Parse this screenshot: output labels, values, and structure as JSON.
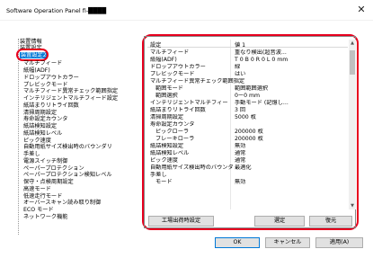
{
  "window": {
    "title": "Software Operation Panel fi-████",
    "close_glyph": "✕"
  },
  "tree": {
    "root_items": [
      "装置情報",
      "装置設定",
      "装置設定2"
    ],
    "selected": "装置設定2",
    "children": [
      "マルチフィード",
      "紙幅(ADF)",
      "ドロップアウトカラー",
      "プレビックモード",
      "マルチフィード異常チェック範囲指定",
      "インテリジェントマルチフィード設定",
      "紙詰まりリトライ回数",
      "清掃周期設定",
      "寿命設定カウンタ",
      "紙詰検知設定",
      "紙詰検知レベル",
      "ピック速度",
      "自動用紙サイズ検出時のバウンダリ",
      "手差し",
      "電源スイッチ制御",
      "ペーパープロテクション",
      "ペーパープロテクション検知レベル",
      "保守・点検周期設定",
      "高速モード",
      "低速走行モード",
      "オーバースキャン読み取り制御",
      "ECO モード",
      "ネットワーク機能"
    ]
  },
  "grid": {
    "col_setting": "設定",
    "col_value": "値 1",
    "rows": [
      [
        "マルチフィード",
        "重なり検出(超音波..."
      ],
      [
        "紙幅(ADF)",
        "T 0  B 0  R 0  L 0 mm"
      ],
      [
        "ドロップアウトカラー",
        "緑"
      ],
      [
        "プレビックモード",
        "はい"
      ],
      [
        "マルチフィード異常チェック範囲指定",
        ""
      ],
      [
        "範囲モード",
        "範囲範囲選択"
      ],
      [
        "範囲選択",
        "0ー0 mm"
      ],
      [
        "インテリジェントマルチフィード設定",
        "手動モード (記憶し..."
      ],
      [
        "紙詰まりリトライ回数",
        "3 回"
      ],
      [
        "清掃周期設定",
        "5000 枚"
      ],
      [
        "寿命設定カウンタ",
        ""
      ],
      [
        "ピックローラ",
        "200000 枚"
      ],
      [
        "ブレーキローラ",
        "200000 枚"
      ],
      [
        "紙詰検知設定",
        "無効"
      ],
      [
        "紙詰検知レベル",
        "通常"
      ],
      [
        "ピック速度",
        "通常"
      ],
      [
        "自動用紙サイズ検出時のバウンダリ",
        "最適化"
      ],
      [
        "手差し",
        ""
      ],
      [
        "モード",
        "無効"
      ]
    ]
  },
  "buttons": {
    "factory_reset": "工場出荷時設定",
    "prev": "選定",
    "restore": "復元",
    "ok": "OK",
    "cancel": "キャンセル",
    "apply": "適用(A)"
  }
}
